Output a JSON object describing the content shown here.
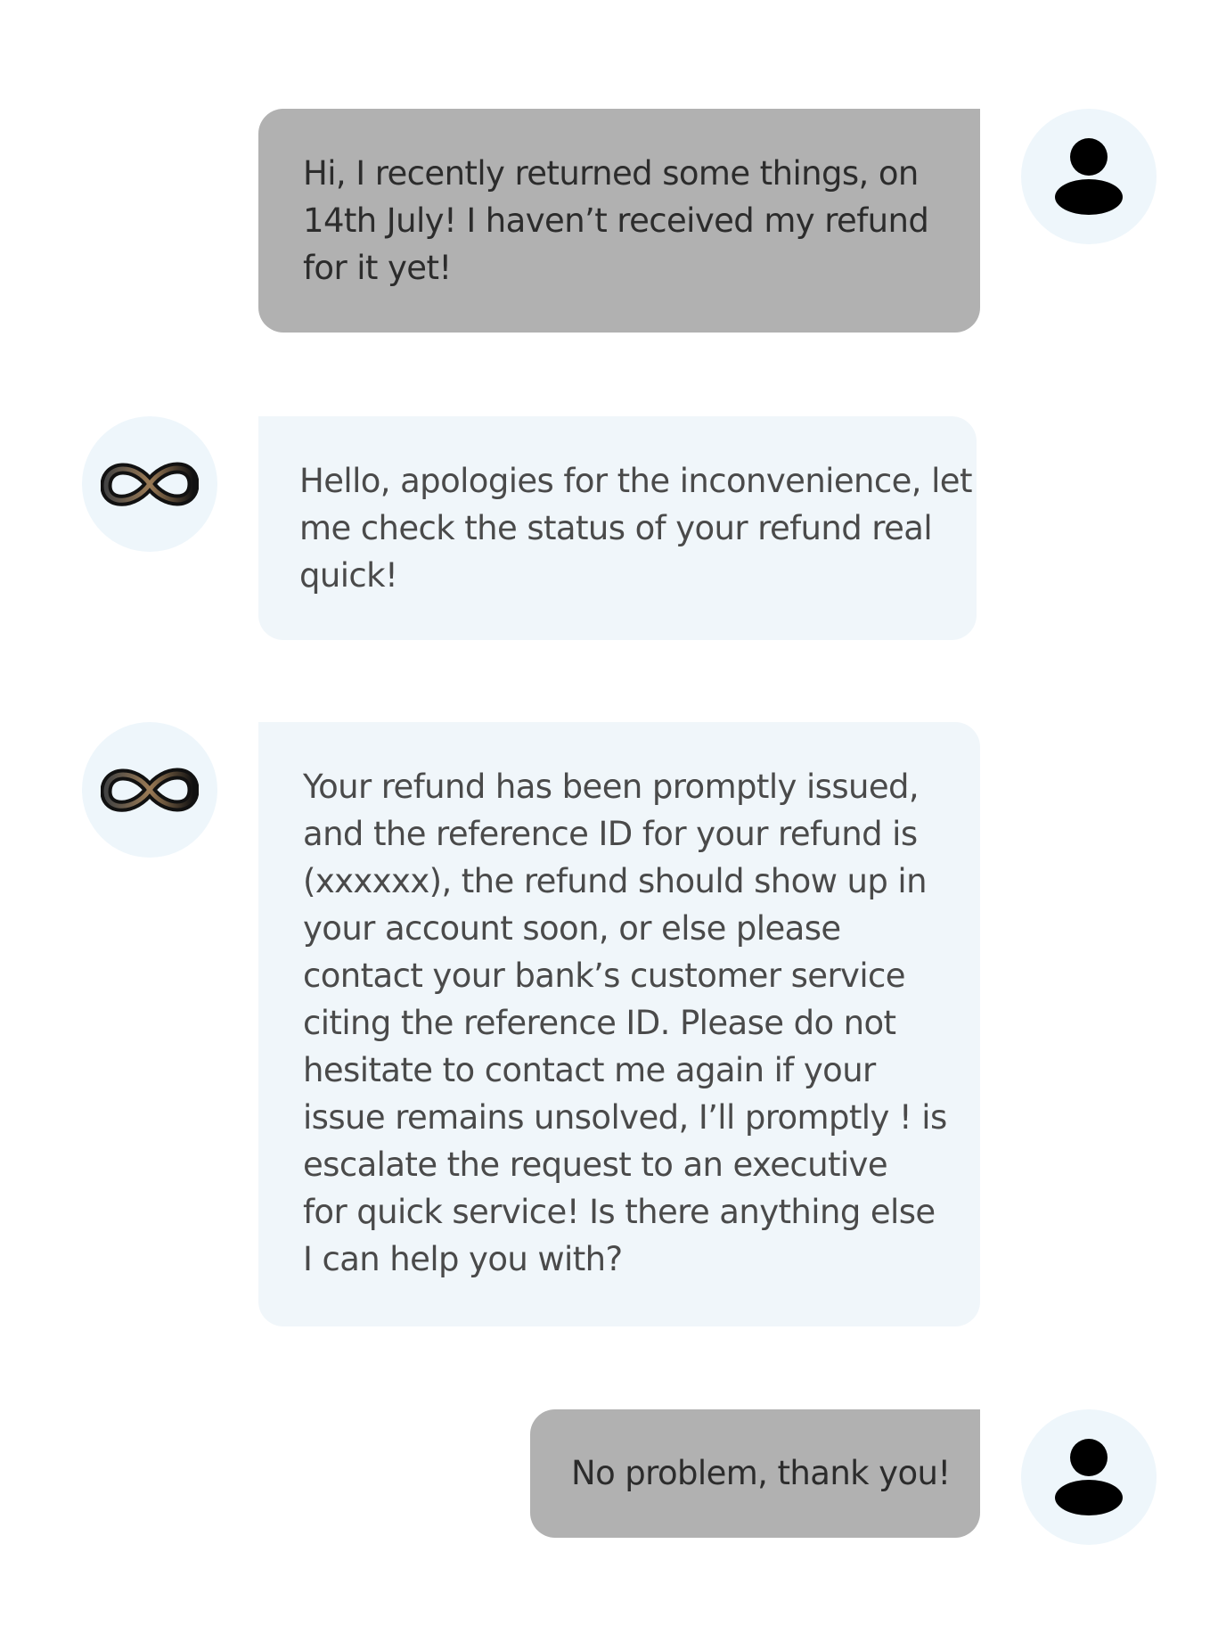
{
  "conversation": {
    "messages": [
      {
        "sender": "user",
        "avatar_icon": "user-icon",
        "lines": [
          "Hi, I recently returned some things, on",
          "14th July! I haven’t received my refund",
          "for it yet!"
        ]
      },
      {
        "sender": "bot",
        "avatar_icon": "infinity-logo-icon",
        "lines": [
          "Hello, apologies for the inconvenience, let",
          "me check the status of your refund real",
          "quick!"
        ]
      },
      {
        "sender": "bot",
        "avatar_icon": "infinity-logo-icon",
        "lines": [
          "Your refund has been promptly issued,",
          "and the reference ID for your refund is",
          "(xxxxxx), the refund should show up in",
          "your account soon, or else please",
          "contact your bank’s customer service",
          "citing the reference ID. Please do not",
          "hesitate to contact me again if your",
          "issue remains unsolved, I’ll promptly ! is",
          "escalate the request to an executive",
          "for quick service! Is there anything else",
          "I can help you with?"
        ]
      },
      {
        "sender": "user",
        "avatar_icon": "user-icon",
        "lines": [
          "No problem, thank you!"
        ]
      }
    ]
  },
  "colors": {
    "user_bubble": "#b1b1b1",
    "bot_bubble": "#f0f6fa",
    "avatar_background": "#eef6fb",
    "user_text": "#2c2c2c",
    "bot_text": "#4a4a4a"
  }
}
